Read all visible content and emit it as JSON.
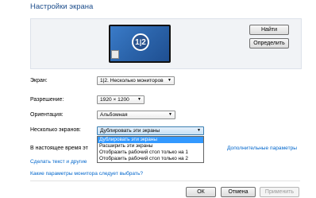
{
  "header": {
    "title": "Настройки экрана"
  },
  "preview": {
    "badge": "1|2",
    "badge_left": "1",
    "badge_right": "2"
  },
  "buttons": {
    "detect": "Найти",
    "identify": "Определить",
    "ok": "ОК",
    "cancel": "Отмена",
    "apply": "Применить"
  },
  "labels": {
    "display": "Экран:",
    "resolution": "Разрешение:",
    "orientation": "Ориентация:",
    "multiple": "Несколько экранов:",
    "current": "В настоящее время эт"
  },
  "values": {
    "display": "1|2. Несколько мониторов",
    "resolution": "1920 × 1200",
    "orientation": "Альбомная",
    "multiple": "Дублировать эти экраны"
  },
  "dropdown": {
    "options": [
      "Дублировать эти экраны",
      "Расширить эти экраны",
      "Отобразить рабочий стол только на 1",
      "Отобразить рабочий стол только на 2"
    ],
    "selected_index": 0
  },
  "links": {
    "advanced": "Дополнительные параметры",
    "text_size": "Сделать текст и другие",
    "which_settings": "Какие параметры монитора следует выбрать?"
  },
  "colors": {
    "accent": "#3399ff",
    "title": "#1e4e8c",
    "link": "#0066cc"
  }
}
